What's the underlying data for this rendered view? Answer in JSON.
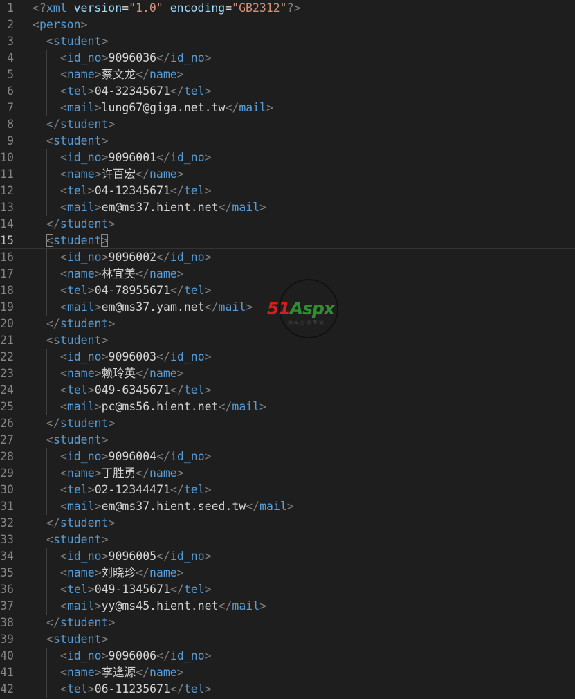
{
  "editor": {
    "colors": {
      "background": "#1e1e1e",
      "line_number": "#858585",
      "tag": "#569cd6",
      "bracket": "#808080",
      "attribute": "#9cdcfe",
      "string": "#ce9178",
      "text": "#d4d4d4"
    },
    "current_line": 15,
    "lines": [
      {
        "n": "1",
        "indent": 0,
        "tokens": [
          [
            "br",
            "<?"
          ],
          [
            "tag",
            "xml"
          ],
          [
            "txt",
            " "
          ],
          [
            "attr",
            "version"
          ],
          [
            "txt",
            "="
          ],
          [
            "str",
            "\"1.0\""
          ],
          [
            "txt",
            " "
          ],
          [
            "attr",
            "encoding"
          ],
          [
            "txt",
            "="
          ],
          [
            "str",
            "\"GB2312\""
          ],
          [
            "br",
            "?>"
          ]
        ]
      },
      {
        "n": "2",
        "indent": 0,
        "tokens": [
          [
            "br",
            "<"
          ],
          [
            "tag",
            "person"
          ],
          [
            "br",
            ">"
          ]
        ]
      },
      {
        "n": "3",
        "indent": 1,
        "tokens": [
          [
            "br",
            "<"
          ],
          [
            "tag",
            "student"
          ],
          [
            "br",
            ">"
          ]
        ]
      },
      {
        "n": "4",
        "indent": 2,
        "tokens": [
          [
            "br",
            "<"
          ],
          [
            "tag",
            "id_no"
          ],
          [
            "br",
            ">"
          ],
          [
            "txt",
            "9096036"
          ],
          [
            "br",
            "</"
          ],
          [
            "tag",
            "id_no"
          ],
          [
            "br",
            ">"
          ]
        ]
      },
      {
        "n": "5",
        "indent": 2,
        "tokens": [
          [
            "br",
            "<"
          ],
          [
            "tag",
            "name"
          ],
          [
            "br",
            ">"
          ],
          [
            "txt",
            "蔡文龙"
          ],
          [
            "br",
            "</"
          ],
          [
            "tag",
            "name"
          ],
          [
            "br",
            ">"
          ]
        ]
      },
      {
        "n": "6",
        "indent": 2,
        "tokens": [
          [
            "br",
            "<"
          ],
          [
            "tag",
            "tel"
          ],
          [
            "br",
            ">"
          ],
          [
            "txt",
            "04-32345671"
          ],
          [
            "br",
            "</"
          ],
          [
            "tag",
            "tel"
          ],
          [
            "br",
            ">"
          ]
        ]
      },
      {
        "n": "7",
        "indent": 2,
        "tokens": [
          [
            "br",
            "<"
          ],
          [
            "tag",
            "mail"
          ],
          [
            "br",
            ">"
          ],
          [
            "txt",
            "lung67@giga.net.tw"
          ],
          [
            "br",
            "</"
          ],
          [
            "tag",
            "mail"
          ],
          [
            "br",
            ">"
          ]
        ]
      },
      {
        "n": "8",
        "indent": 1,
        "tokens": [
          [
            "br",
            "</"
          ],
          [
            "tag",
            "student"
          ],
          [
            "br",
            ">"
          ]
        ]
      },
      {
        "n": "9",
        "indent": 1,
        "tokens": [
          [
            "br",
            "<"
          ],
          [
            "tag",
            "student"
          ],
          [
            "br",
            ">"
          ]
        ]
      },
      {
        "n": "10",
        "indent": 2,
        "tokens": [
          [
            "br",
            "<"
          ],
          [
            "tag",
            "id_no"
          ],
          [
            "br",
            ">"
          ],
          [
            "txt",
            "9096001"
          ],
          [
            "br",
            "</"
          ],
          [
            "tag",
            "id_no"
          ],
          [
            "br",
            ">"
          ]
        ]
      },
      {
        "n": "11",
        "indent": 2,
        "tokens": [
          [
            "br",
            "<"
          ],
          [
            "tag",
            "name"
          ],
          [
            "br",
            ">"
          ],
          [
            "txt",
            "许百宏"
          ],
          [
            "br",
            "</"
          ],
          [
            "tag",
            "name"
          ],
          [
            "br",
            ">"
          ]
        ]
      },
      {
        "n": "12",
        "indent": 2,
        "tokens": [
          [
            "br",
            "<"
          ],
          [
            "tag",
            "tel"
          ],
          [
            "br",
            ">"
          ],
          [
            "txt",
            "04-12345671"
          ],
          [
            "br",
            "</"
          ],
          [
            "tag",
            "tel"
          ],
          [
            "br",
            ">"
          ]
        ]
      },
      {
        "n": "13",
        "indent": 2,
        "tokens": [
          [
            "br",
            "<"
          ],
          [
            "tag",
            "mail"
          ],
          [
            "br",
            ">"
          ],
          [
            "txt",
            "em@ms37.hient.net"
          ],
          [
            "br",
            "</"
          ],
          [
            "tag",
            "mail"
          ],
          [
            "br",
            ">"
          ]
        ]
      },
      {
        "n": "14",
        "indent": 1,
        "tokens": [
          [
            "br",
            "</"
          ],
          [
            "tag",
            "student"
          ],
          [
            "br",
            ">"
          ]
        ]
      },
      {
        "n": "15",
        "indent": 1,
        "tokens": [
          [
            "match",
            "<"
          ],
          [
            "tag",
            "student"
          ],
          [
            "match",
            ">"
          ]
        ]
      },
      {
        "n": "16",
        "indent": 2,
        "tokens": [
          [
            "br",
            "<"
          ],
          [
            "tag",
            "id_no"
          ],
          [
            "br",
            ">"
          ],
          [
            "txt",
            "9096002"
          ],
          [
            "br",
            "</"
          ],
          [
            "tag",
            "id_no"
          ],
          [
            "br",
            ">"
          ]
        ]
      },
      {
        "n": "17",
        "indent": 2,
        "tokens": [
          [
            "br",
            "<"
          ],
          [
            "tag",
            "name"
          ],
          [
            "br",
            ">"
          ],
          [
            "txt",
            "林宜美"
          ],
          [
            "br",
            "</"
          ],
          [
            "tag",
            "name"
          ],
          [
            "br",
            ">"
          ]
        ]
      },
      {
        "n": "18",
        "indent": 2,
        "tokens": [
          [
            "br",
            "<"
          ],
          [
            "tag",
            "tel"
          ],
          [
            "br",
            ">"
          ],
          [
            "txt",
            "04-78955671"
          ],
          [
            "br",
            "</"
          ],
          [
            "tag",
            "tel"
          ],
          [
            "br",
            ">"
          ]
        ]
      },
      {
        "n": "19",
        "indent": 2,
        "tokens": [
          [
            "br",
            "<"
          ],
          [
            "tag",
            "mail"
          ],
          [
            "br",
            ">"
          ],
          [
            "txt",
            "em@ms37.yam.net"
          ],
          [
            "br",
            "</"
          ],
          [
            "tag",
            "mail"
          ],
          [
            "br",
            ">"
          ]
        ]
      },
      {
        "n": "20",
        "indent": 1,
        "tokens": [
          [
            "br",
            "</"
          ],
          [
            "tag",
            "student"
          ],
          [
            "br",
            ">"
          ]
        ]
      },
      {
        "n": "21",
        "indent": 1,
        "tokens": [
          [
            "br",
            "<"
          ],
          [
            "tag",
            "student"
          ],
          [
            "br",
            ">"
          ]
        ]
      },
      {
        "n": "22",
        "indent": 2,
        "tokens": [
          [
            "br",
            "<"
          ],
          [
            "tag",
            "id_no"
          ],
          [
            "br",
            ">"
          ],
          [
            "txt",
            "9096003"
          ],
          [
            "br",
            "</"
          ],
          [
            "tag",
            "id_no"
          ],
          [
            "br",
            ">"
          ]
        ]
      },
      {
        "n": "23",
        "indent": 2,
        "tokens": [
          [
            "br",
            "<"
          ],
          [
            "tag",
            "name"
          ],
          [
            "br",
            ">"
          ],
          [
            "txt",
            "赖玲英"
          ],
          [
            "br",
            "</"
          ],
          [
            "tag",
            "name"
          ],
          [
            "br",
            ">"
          ]
        ]
      },
      {
        "n": "24",
        "indent": 2,
        "tokens": [
          [
            "br",
            "<"
          ],
          [
            "tag",
            "tel"
          ],
          [
            "br",
            ">"
          ],
          [
            "txt",
            "049-6345671"
          ],
          [
            "br",
            "</"
          ],
          [
            "tag",
            "tel"
          ],
          [
            "br",
            ">"
          ]
        ]
      },
      {
        "n": "25",
        "indent": 2,
        "tokens": [
          [
            "br",
            "<"
          ],
          [
            "tag",
            "mail"
          ],
          [
            "br",
            ">"
          ],
          [
            "txt",
            "pc@ms56.hient.net"
          ],
          [
            "br",
            "</"
          ],
          [
            "tag",
            "mail"
          ],
          [
            "br",
            ">"
          ]
        ]
      },
      {
        "n": "26",
        "indent": 1,
        "tokens": [
          [
            "br",
            "</"
          ],
          [
            "tag",
            "student"
          ],
          [
            "br",
            ">"
          ]
        ]
      },
      {
        "n": "27",
        "indent": 1,
        "tokens": [
          [
            "br",
            "<"
          ],
          [
            "tag",
            "student"
          ],
          [
            "br",
            ">"
          ]
        ]
      },
      {
        "n": "28",
        "indent": 2,
        "tokens": [
          [
            "br",
            "<"
          ],
          [
            "tag",
            "id_no"
          ],
          [
            "br",
            ">"
          ],
          [
            "txt",
            "9096004"
          ],
          [
            "br",
            "</"
          ],
          [
            "tag",
            "id_no"
          ],
          [
            "br",
            ">"
          ]
        ]
      },
      {
        "n": "29",
        "indent": 2,
        "tokens": [
          [
            "br",
            "<"
          ],
          [
            "tag",
            "name"
          ],
          [
            "br",
            ">"
          ],
          [
            "txt",
            "丁胜勇"
          ],
          [
            "br",
            "</"
          ],
          [
            "tag",
            "name"
          ],
          [
            "br",
            ">"
          ]
        ]
      },
      {
        "n": "30",
        "indent": 2,
        "tokens": [
          [
            "br",
            "<"
          ],
          [
            "tag",
            "tel"
          ],
          [
            "br",
            ">"
          ],
          [
            "txt",
            "02-12344471"
          ],
          [
            "br",
            "</"
          ],
          [
            "tag",
            "tel"
          ],
          [
            "br",
            ">"
          ]
        ]
      },
      {
        "n": "31",
        "indent": 2,
        "tokens": [
          [
            "br",
            "<"
          ],
          [
            "tag",
            "mail"
          ],
          [
            "br",
            ">"
          ],
          [
            "txt",
            "em@ms37.hient.seed.tw"
          ],
          [
            "br",
            "</"
          ],
          [
            "tag",
            "mail"
          ],
          [
            "br",
            ">"
          ]
        ]
      },
      {
        "n": "32",
        "indent": 1,
        "tokens": [
          [
            "br",
            "</"
          ],
          [
            "tag",
            "student"
          ],
          [
            "br",
            ">"
          ]
        ]
      },
      {
        "n": "33",
        "indent": 1,
        "tokens": [
          [
            "br",
            "<"
          ],
          [
            "tag",
            "student"
          ],
          [
            "br",
            ">"
          ]
        ]
      },
      {
        "n": "34",
        "indent": 2,
        "tokens": [
          [
            "br",
            "<"
          ],
          [
            "tag",
            "id_no"
          ],
          [
            "br",
            ">"
          ],
          [
            "txt",
            "9096005"
          ],
          [
            "br",
            "</"
          ],
          [
            "tag",
            "id_no"
          ],
          [
            "br",
            ">"
          ]
        ]
      },
      {
        "n": "35",
        "indent": 2,
        "tokens": [
          [
            "br",
            "<"
          ],
          [
            "tag",
            "name"
          ],
          [
            "br",
            ">"
          ],
          [
            "txt",
            "刘晓珍"
          ],
          [
            "br",
            "</"
          ],
          [
            "tag",
            "name"
          ],
          [
            "br",
            ">"
          ]
        ]
      },
      {
        "n": "36",
        "indent": 2,
        "tokens": [
          [
            "br",
            "<"
          ],
          [
            "tag",
            "tel"
          ],
          [
            "br",
            ">"
          ],
          [
            "txt",
            "049-1345671"
          ],
          [
            "br",
            "</"
          ],
          [
            "tag",
            "tel"
          ],
          [
            "br",
            ">"
          ]
        ]
      },
      {
        "n": "37",
        "indent": 2,
        "tokens": [
          [
            "br",
            "<"
          ],
          [
            "tag",
            "mail"
          ],
          [
            "br",
            ">"
          ],
          [
            "txt",
            "yy@ms45.hient.net"
          ],
          [
            "br",
            "</"
          ],
          [
            "tag",
            "mail"
          ],
          [
            "br",
            ">"
          ]
        ]
      },
      {
        "n": "38",
        "indent": 1,
        "tokens": [
          [
            "br",
            "</"
          ],
          [
            "tag",
            "student"
          ],
          [
            "br",
            ">"
          ]
        ]
      },
      {
        "n": "39",
        "indent": 1,
        "tokens": [
          [
            "br",
            "<"
          ],
          [
            "tag",
            "student"
          ],
          [
            "br",
            ">"
          ]
        ]
      },
      {
        "n": "40",
        "indent": 2,
        "tokens": [
          [
            "br",
            "<"
          ],
          [
            "tag",
            "id_no"
          ],
          [
            "br",
            ">"
          ],
          [
            "txt",
            "9096006"
          ],
          [
            "br",
            "</"
          ],
          [
            "tag",
            "id_no"
          ],
          [
            "br",
            ">"
          ]
        ]
      },
      {
        "n": "41",
        "indent": 2,
        "tokens": [
          [
            "br",
            "<"
          ],
          [
            "tag",
            "name"
          ],
          [
            "br",
            ">"
          ],
          [
            "txt",
            "李逢源"
          ],
          [
            "br",
            "</"
          ],
          [
            "tag",
            "name"
          ],
          [
            "br",
            ">"
          ]
        ]
      },
      {
        "n": "42",
        "indent": 2,
        "tokens": [
          [
            "br",
            "<"
          ],
          [
            "tag",
            "tel"
          ],
          [
            "br",
            ">"
          ],
          [
            "txt",
            "06-11235671"
          ],
          [
            "br",
            "</"
          ],
          [
            "tag",
            "tel"
          ],
          [
            "br",
            ">"
          ]
        ]
      }
    ]
  },
  "watermark": {
    "logo_red": "51",
    "logo_green": "Aspx",
    "subtitle": "源码分享专家"
  }
}
